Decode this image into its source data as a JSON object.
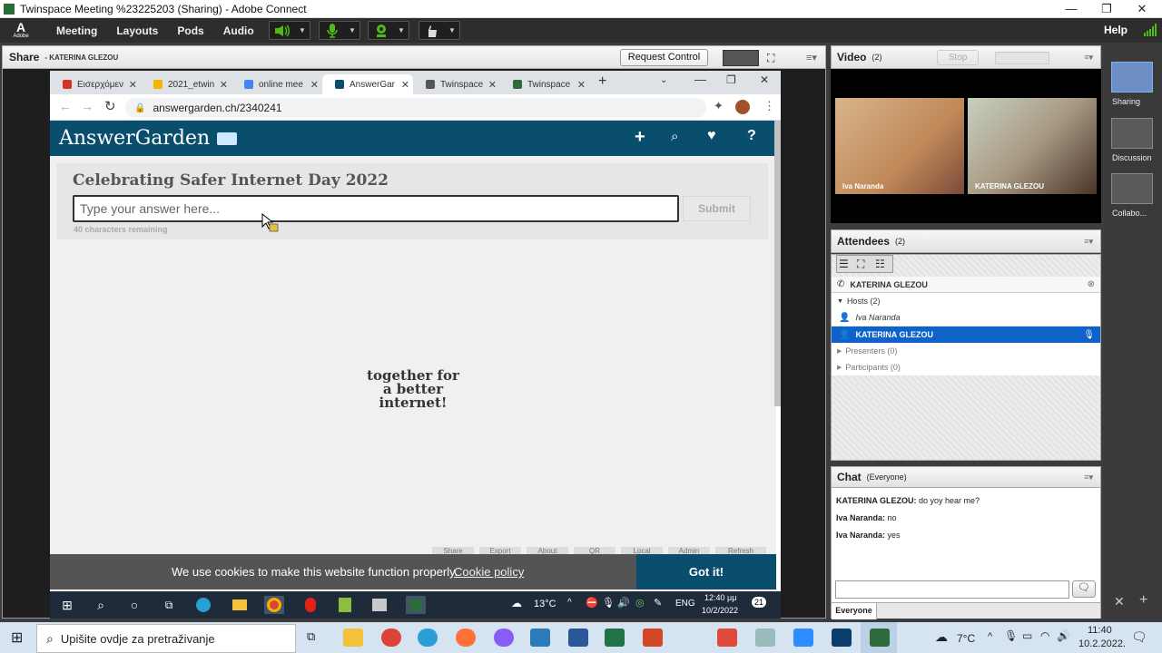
{
  "window": {
    "title": "Twinspace Meeting %23225203 (Sharing) - Adobe Connect",
    "minimize": "—",
    "maximize": "❐",
    "close": "✕"
  },
  "menubar": {
    "logo": "A",
    "logo_sub": "Adobe",
    "items": [
      "Meeting",
      "Layouts",
      "Pods",
      "Audio"
    ],
    "help": "Help"
  },
  "share_pod": {
    "title": "Share",
    "presenter": "- KATERINA GLEZOU",
    "request_control": "Request Control"
  },
  "browser": {
    "tabs": [
      {
        "label": "Εισερχόμεν",
        "color": "#d93025"
      },
      {
        "label": "2021_etwin",
        "color": "#1a73e8"
      },
      {
        "label": "online mee",
        "color": "#4285f4"
      },
      {
        "label": "AnswerGar",
        "color": "#0a4e6e"
      },
      {
        "label": "Twinspace",
        "color": "#555555"
      },
      {
        "label": "Twinspace",
        "color": "#2c6b3a"
      }
    ],
    "new_tab": "+",
    "url": "answergarden.ch/2340241"
  },
  "answergarden": {
    "logo": "AnswerGarden",
    "title": "Celebrating Safer Internet Day 2022",
    "input_placeholder": "Type your answer here...",
    "submit": "Submit",
    "remaining": "40 characters remaining",
    "answer_line1": "together for",
    "answer_line2": "a better",
    "answer_line3": "internet!",
    "footer_buttons": [
      "Share",
      "Export",
      "About",
      "QR",
      "Local",
      "Admin",
      "Refresh"
    ],
    "cookie_msg": "We use cookies to make this website function properly.",
    "cookie_link": "Cookie policy",
    "cookie_ok": "Got it!"
  },
  "inner_taskbar": {
    "temp": "13°C",
    "lang": "ENG",
    "time": "12:40 μμ",
    "date": "10/2/2022",
    "notif": "21"
  },
  "video_pod": {
    "title": "Video",
    "count": "(2)",
    "stop": "Stop",
    "participants": [
      "Iva Naranda",
      "KATERINA GLEZOU"
    ]
  },
  "attendees_pod": {
    "title": "Attendees",
    "count": "(2)",
    "me": "KATERINA GLEZOU",
    "hosts_label": "Hosts (2)",
    "hosts": [
      "Iva Naranda",
      "KATERINA GLEZOU"
    ],
    "presenters": "Presenters (0)",
    "participants": "Participants (0)"
  },
  "chat_pod": {
    "title": "Chat",
    "scope": "(Everyone)",
    "messages": [
      {
        "from": "KATERINA GLEZOU:",
        "text": "do yoy hear me?"
      },
      {
        "from": "Iva Naranda:",
        "text": "no"
      },
      {
        "from": "Iva Naranda:",
        "text": "yes"
      }
    ],
    "tab_everyone": "Everyone"
  },
  "layouts_rail": [
    "Sharing",
    "Discussion",
    "Collabo..."
  ],
  "windows_taskbar": {
    "search_placeholder": "Upišite ovdje za pretraživanje",
    "temp": "7°C",
    "time": "11:40",
    "date": "10.2.2022."
  }
}
